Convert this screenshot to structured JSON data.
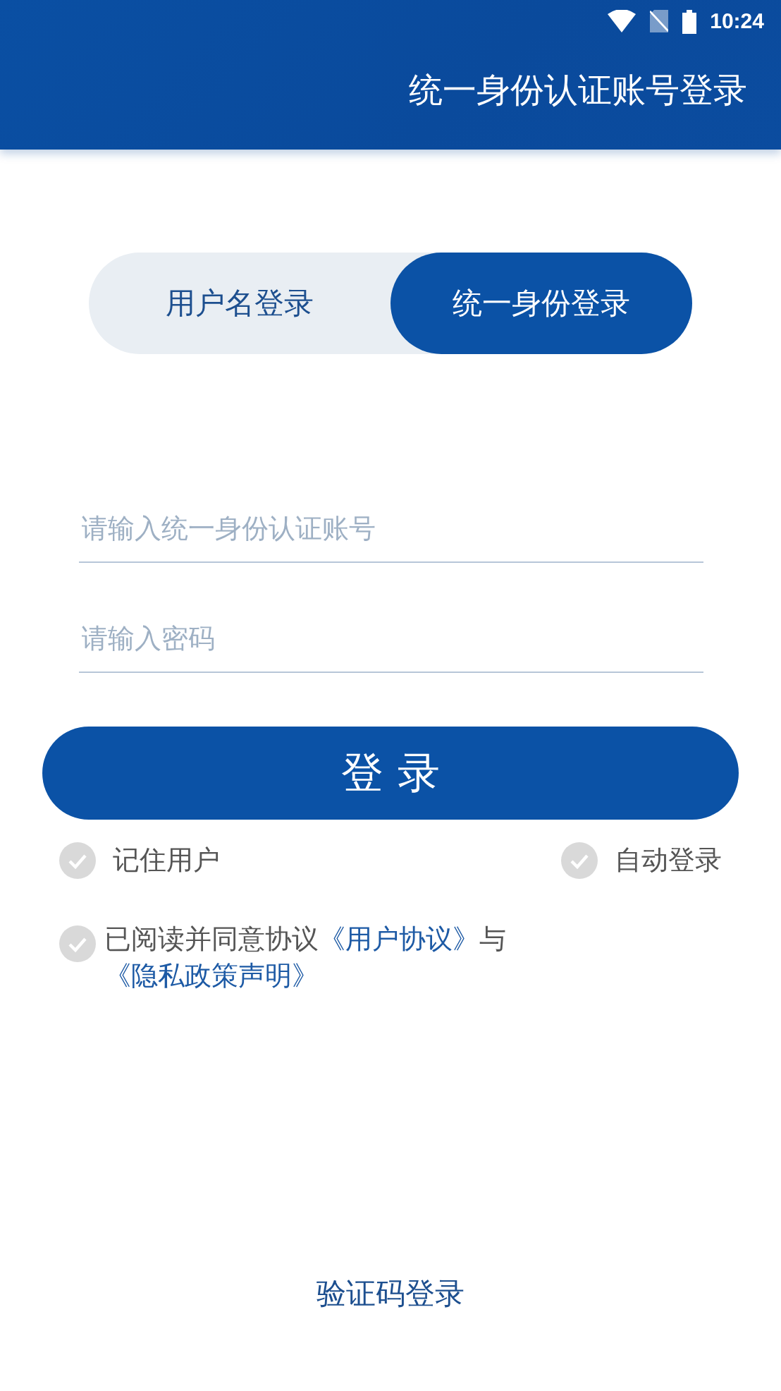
{
  "status_bar": {
    "time": "10:24"
  },
  "header": {
    "title": "统一身份认证账号登录"
  },
  "tabs": [
    {
      "label": "用户名登录",
      "selected": false
    },
    {
      "label": "统一身份登录",
      "selected": true
    }
  ],
  "fields": [
    {
      "placeholder": "请输入统一身份认证账号"
    },
    {
      "placeholder": "请输入密码"
    }
  ],
  "login_button": "登 录",
  "options": [
    {
      "label": "记住用户",
      "checked": false
    },
    {
      "label": "自动登录",
      "checked": false
    }
  ],
  "agreement": {
    "checked": false,
    "text": "已阅读并同意协议",
    "link_1": "《用户协议》",
    "joiner": "与",
    "link_2": "《隐私政策声明》"
  },
  "sms_login": "验证码登录"
}
